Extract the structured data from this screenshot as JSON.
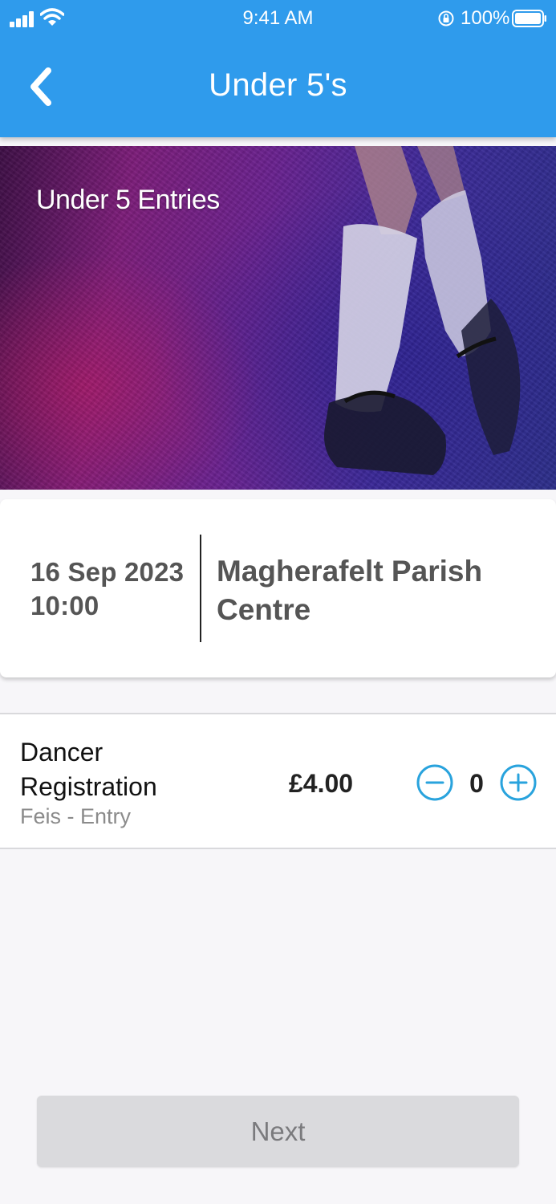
{
  "status_bar": {
    "time": "9:41 AM",
    "battery": "100%",
    "icons": [
      "signal-icon",
      "wifi-icon",
      "orientation-lock-icon",
      "battery-icon"
    ]
  },
  "header": {
    "title": "Under 5's",
    "back_icon": "chevron-left-icon",
    "color": "#2f9bec"
  },
  "banner": {
    "text": "Under 5 Entries"
  },
  "event": {
    "date": "16 Sep 2023",
    "time": "10:00",
    "venue": "Magherafelt Parish Centre"
  },
  "tickets": [
    {
      "name": "Dancer Registration",
      "category": "Feis - Entry",
      "price": "£4.00",
      "quantity": "0",
      "minus_icon": "minus-circle-icon",
      "plus_icon": "plus-circle-icon"
    }
  ],
  "footer": {
    "next_label": "Next",
    "next_enabled": false
  },
  "colors": {
    "accent": "#2f9bec",
    "stepper": "#29a3dd"
  }
}
